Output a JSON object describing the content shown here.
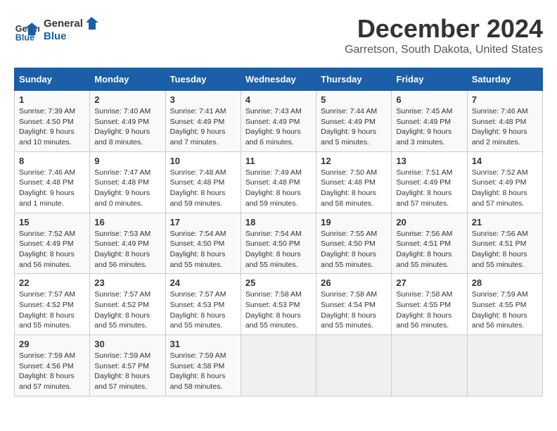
{
  "logo": {
    "line1": "General",
    "line2": "Blue"
  },
  "title": "December 2024",
  "subtitle": "Garretson, South Dakota, United States",
  "days_of_week": [
    "Sunday",
    "Monday",
    "Tuesday",
    "Wednesday",
    "Thursday",
    "Friday",
    "Saturday"
  ],
  "weeks": [
    [
      {
        "day": 1,
        "info": "Sunrise: 7:39 AM\nSunset: 4:50 PM\nDaylight: 9 hours\nand 10 minutes."
      },
      {
        "day": 2,
        "info": "Sunrise: 7:40 AM\nSunset: 4:49 PM\nDaylight: 9 hours\nand 8 minutes."
      },
      {
        "day": 3,
        "info": "Sunrise: 7:41 AM\nSunset: 4:49 PM\nDaylight: 9 hours\nand 7 minutes."
      },
      {
        "day": 4,
        "info": "Sunrise: 7:43 AM\nSunset: 4:49 PM\nDaylight: 9 hours\nand 6 minutes."
      },
      {
        "day": 5,
        "info": "Sunrise: 7:44 AM\nSunset: 4:49 PM\nDaylight: 9 hours\nand 5 minutes."
      },
      {
        "day": 6,
        "info": "Sunrise: 7:45 AM\nSunset: 4:49 PM\nDaylight: 9 hours\nand 3 minutes."
      },
      {
        "day": 7,
        "info": "Sunrise: 7:46 AM\nSunset: 4:48 PM\nDaylight: 9 hours\nand 2 minutes."
      }
    ],
    [
      {
        "day": 8,
        "info": "Sunrise: 7:46 AM\nSunset: 4:48 PM\nDaylight: 9 hours\nand 1 minute."
      },
      {
        "day": 9,
        "info": "Sunrise: 7:47 AM\nSunset: 4:48 PM\nDaylight: 9 hours\nand 0 minutes."
      },
      {
        "day": 10,
        "info": "Sunrise: 7:48 AM\nSunset: 4:48 PM\nDaylight: 8 hours\nand 59 minutes."
      },
      {
        "day": 11,
        "info": "Sunrise: 7:49 AM\nSunset: 4:48 PM\nDaylight: 8 hours\nand 59 minutes."
      },
      {
        "day": 12,
        "info": "Sunrise: 7:50 AM\nSunset: 4:48 PM\nDaylight: 8 hours\nand 58 minutes."
      },
      {
        "day": 13,
        "info": "Sunrise: 7:51 AM\nSunset: 4:49 PM\nDaylight: 8 hours\nand 57 minutes."
      },
      {
        "day": 14,
        "info": "Sunrise: 7:52 AM\nSunset: 4:49 PM\nDaylight: 8 hours\nand 57 minutes."
      }
    ],
    [
      {
        "day": 15,
        "info": "Sunrise: 7:52 AM\nSunset: 4:49 PM\nDaylight: 8 hours\nand 56 minutes."
      },
      {
        "day": 16,
        "info": "Sunrise: 7:53 AM\nSunset: 4:49 PM\nDaylight: 8 hours\nand 56 minutes."
      },
      {
        "day": 17,
        "info": "Sunrise: 7:54 AM\nSunset: 4:50 PM\nDaylight: 8 hours\nand 55 minutes."
      },
      {
        "day": 18,
        "info": "Sunrise: 7:54 AM\nSunset: 4:50 PM\nDaylight: 8 hours\nand 55 minutes."
      },
      {
        "day": 19,
        "info": "Sunrise: 7:55 AM\nSunset: 4:50 PM\nDaylight: 8 hours\nand 55 minutes."
      },
      {
        "day": 20,
        "info": "Sunrise: 7:56 AM\nSunset: 4:51 PM\nDaylight: 8 hours\nand 55 minutes."
      },
      {
        "day": 21,
        "info": "Sunrise: 7:56 AM\nSunset: 4:51 PM\nDaylight: 8 hours\nand 55 minutes."
      }
    ],
    [
      {
        "day": 22,
        "info": "Sunrise: 7:57 AM\nSunset: 4:52 PM\nDaylight: 8 hours\nand 55 minutes."
      },
      {
        "day": 23,
        "info": "Sunrise: 7:57 AM\nSunset: 4:52 PM\nDaylight: 8 hours\nand 55 minutes."
      },
      {
        "day": 24,
        "info": "Sunrise: 7:57 AM\nSunset: 4:53 PM\nDaylight: 8 hours\nand 55 minutes."
      },
      {
        "day": 25,
        "info": "Sunrise: 7:58 AM\nSunset: 4:53 PM\nDaylight: 8 hours\nand 55 minutes."
      },
      {
        "day": 26,
        "info": "Sunrise: 7:58 AM\nSunset: 4:54 PM\nDaylight: 8 hours\nand 55 minutes."
      },
      {
        "day": 27,
        "info": "Sunrise: 7:58 AM\nSunset: 4:55 PM\nDaylight: 8 hours\nand 56 minutes."
      },
      {
        "day": 28,
        "info": "Sunrise: 7:59 AM\nSunset: 4:55 PM\nDaylight: 8 hours\nand 56 minutes."
      }
    ],
    [
      {
        "day": 29,
        "info": "Sunrise: 7:59 AM\nSunset: 4:56 PM\nDaylight: 8 hours\nand 57 minutes."
      },
      {
        "day": 30,
        "info": "Sunrise: 7:59 AM\nSunset: 4:57 PM\nDaylight: 8 hours\nand 57 minutes."
      },
      {
        "day": 31,
        "info": "Sunrise: 7:59 AM\nSunset: 4:58 PM\nDaylight: 8 hours\nand 58 minutes."
      },
      null,
      null,
      null,
      null
    ]
  ]
}
